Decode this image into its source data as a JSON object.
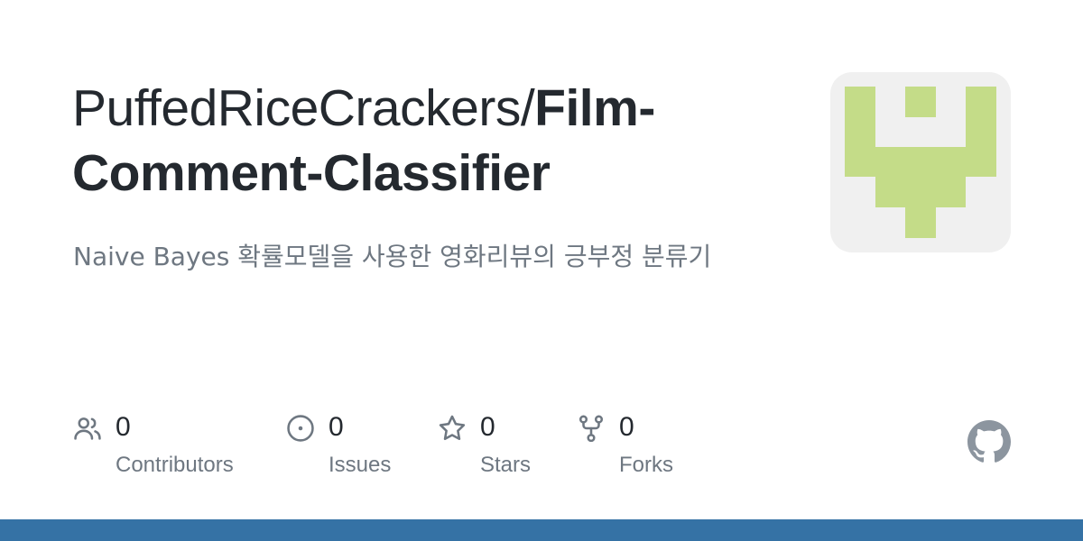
{
  "repo": {
    "owner": "PuffedRiceCrackers/",
    "name": "Film-Comment-Classifier",
    "description": "Naive Bayes 확률모델을 사용한 영화리뷰의 긍부정 분류기"
  },
  "stats": [
    {
      "icon": "people-icon",
      "count": "0",
      "label": "Contributors"
    },
    {
      "icon": "issue-icon",
      "count": "0",
      "label": "Issues"
    },
    {
      "icon": "star-icon",
      "count": "0",
      "label": "Stars"
    },
    {
      "icon": "fork-icon",
      "count": "0",
      "label": "Forks"
    }
  ],
  "colors": {
    "language_bar": "#3572a5",
    "avatar_fill": "#c4dc88",
    "avatar_background": "#f0f0f0",
    "title": "#24292f",
    "muted": "#6e7781"
  },
  "branding": {
    "logo": "github-logo-icon"
  }
}
